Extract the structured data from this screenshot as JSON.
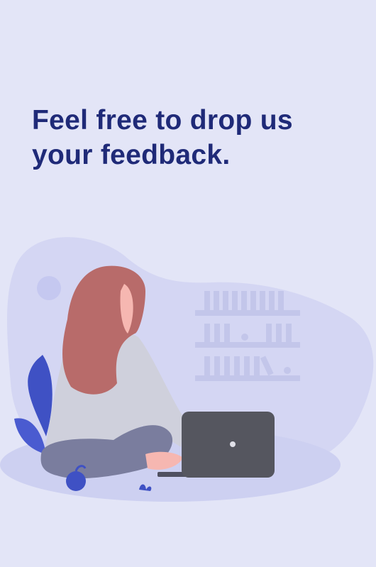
{
  "feedback": {
    "headline_line1": "Feel free to drop us",
    "headline_line2": "your feedback."
  },
  "colors": {
    "background": "#e3e5f7",
    "headline": "#1f2a78",
    "accent": "#3f51c4"
  },
  "illustration": {
    "icon": "person-with-laptop-illustration"
  }
}
